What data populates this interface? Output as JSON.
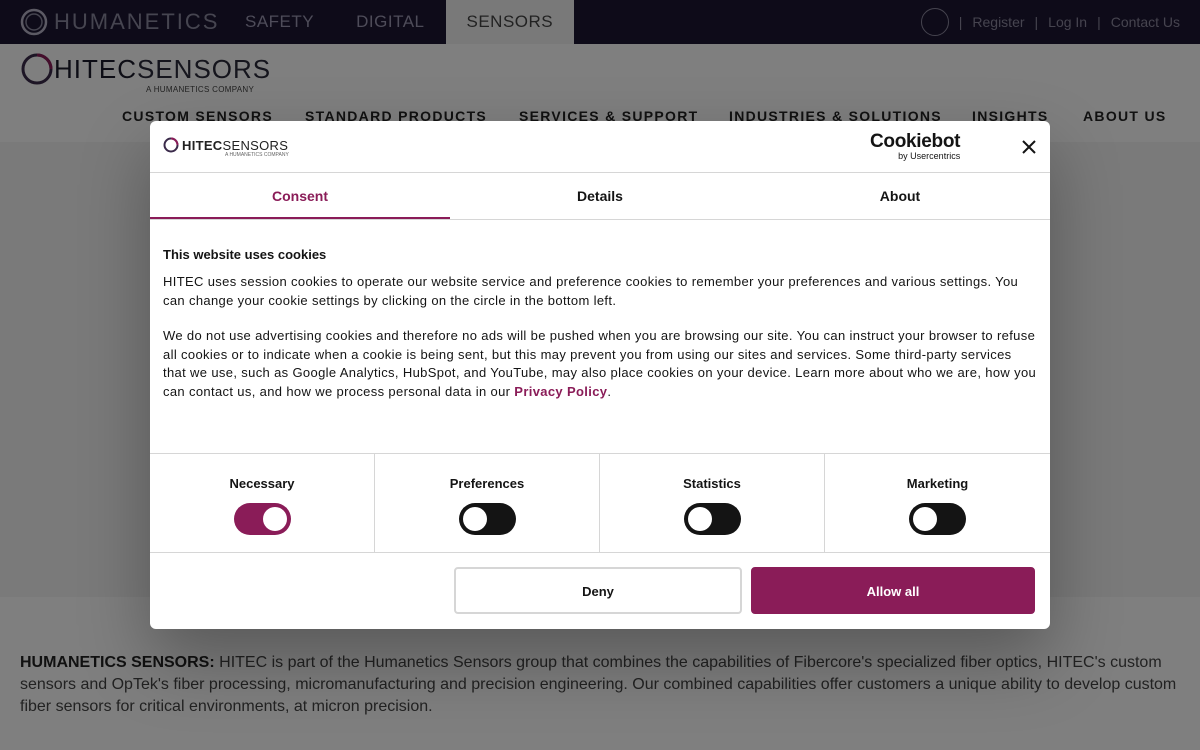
{
  "topbar": {
    "logo": "HUMANETICS",
    "tabs": [
      "SAFETY",
      "DIGITAL",
      "SENSORS"
    ],
    "active_tab": "SENSORS",
    "links": [
      "Register",
      "Log In",
      "Contact Us"
    ],
    "separator": "|"
  },
  "header": {
    "logo_bold": "HITEC",
    "logo_light": "SENSORS",
    "logo_sub": "A HUMANETICS COMPANY",
    "nav": [
      "CUSTOM SENSORS",
      "STANDARD PRODUCTS",
      "SERVICES & SUPPORT",
      "INDUSTRIES & SOLUTIONS",
      "INSIGHTS",
      "ABOUT US"
    ]
  },
  "intro": {
    "lead": "HUMANETICS SENSORS:",
    "text": " HITEC is part of the Humanetics Sensors group that combines the capabilities of Fibercore's specialized fiber optics, HITEC's custom sensors and OpTek's fiber processing, micromanufacturing and precision engineering. Our combined capabilities offer customers a unique ability to develop custom fiber sensors for critical environments, at micron precision."
  },
  "dialog": {
    "logo_bold": "HITEC",
    "logo_light": "SENSORS",
    "logo_sub": "A HUMANETICS COMPANY",
    "provider": "Cookiebot",
    "provider_sub": "by Usercentrics",
    "tabs": [
      "Consent",
      "Details",
      "About"
    ],
    "active_tab": "Consent",
    "title": "This website uses cookies",
    "para1": "HITEC uses session cookies to operate our website service and preference cookies to remember your preferences and various settings. You can change your cookie settings by clicking on the circle in the bottom left.",
    "para2": "We do not use advertising cookies and therefore no ads will be pushed when you are browsing our site. You can instruct your browser to refuse all cookies or to indicate when a cookie is being sent, but this may prevent you from using our sites and services. Some third-party services that we use, such as Google Analytics, HubSpot, and YouTube, may also place cookies on your device. Learn more about who we are, how you can contact us, and how we process personal data in our ",
    "privacy_link": "Privacy Policy",
    "para2_end": ".",
    "toggles": [
      {
        "label": "Necessary",
        "on": true
      },
      {
        "label": "Preferences",
        "on": false
      },
      {
        "label": "Statistics",
        "on": false
      },
      {
        "label": "Marketing",
        "on": false
      }
    ],
    "deny_label": "Deny",
    "allow_label": "Allow all"
  },
  "colors": {
    "accent": "#8a1c58",
    "topbar": "#1c1733"
  }
}
